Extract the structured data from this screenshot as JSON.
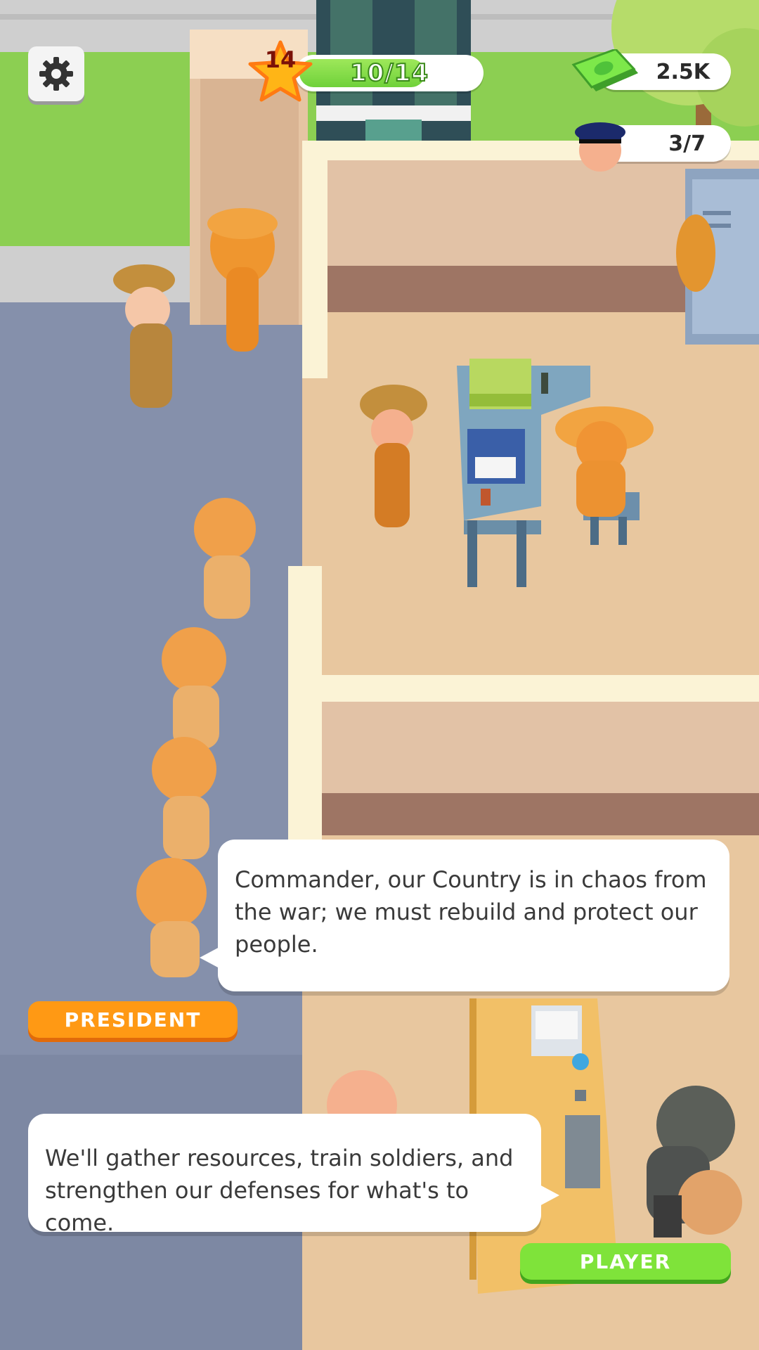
{
  "hud": {
    "settings_icon": "gear-icon",
    "level": "14",
    "level_progress": "10/14",
    "progress_fraction": 0.714,
    "money": "2.5K",
    "money_icon": "cash-icon",
    "officers": "3/7",
    "officer_icon": "officer-cap-icon"
  },
  "dialog": {
    "president": {
      "text": "Commander, our Country is in chaos from the war; we must rebuild and protect our people.",
      "speaker": "PRESIDENT"
    },
    "player": {
      "text": "We'll gather resources, train soldiers, and strengthen our defenses for what's to come.",
      "speaker": "PLAYER"
    }
  },
  "colors": {
    "president_tag": "#ff9914",
    "player_tag": "#7fe33a",
    "progress_fill": "#6fd13a"
  }
}
